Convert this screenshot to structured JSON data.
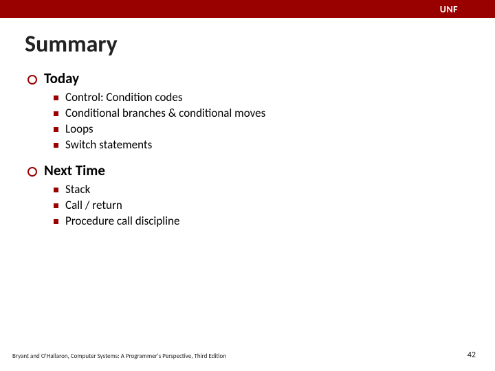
{
  "header": {
    "org": "UNF"
  },
  "title": "Summary",
  "sections": [
    {
      "heading": "Today",
      "items": [
        "Control: Condition codes",
        "Conditional branches & conditional moves",
        "Loops",
        "Switch statements"
      ]
    },
    {
      "heading": "Next Time",
      "items": [
        "Stack",
        "Call / return",
        "Procedure call discipline"
      ]
    }
  ],
  "footer": "Bryant and O'Hallaron, Computer Systems: A Programmer's Perspective, Third Edition",
  "page": "42"
}
